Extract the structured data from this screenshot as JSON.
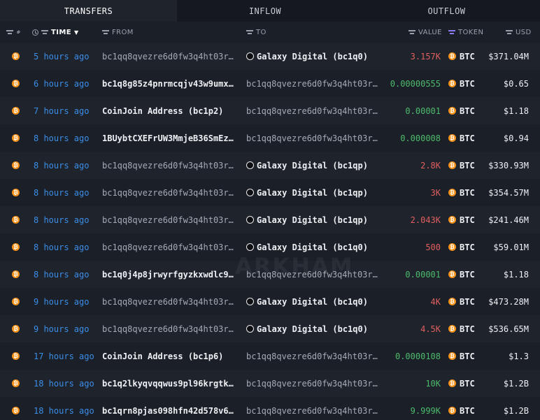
{
  "tabs": [
    "TRANSFERS",
    "INFLOW",
    "OUTFLOW"
  ],
  "active_tab": 0,
  "columns": {
    "time": "TIME",
    "from": "FROM",
    "to": "TO",
    "value": "VALUE",
    "token": "TOKEN",
    "usd": "USD"
  },
  "watermark": "ARKHAM",
  "rows": [
    {
      "time": "5 hours ago",
      "from": "bc1qq8qvezre6d0fw3q4ht03r…",
      "from_type": "addr",
      "to": "Galaxy Digital (bc1q0)",
      "to_type": "entity",
      "value": "3.157K",
      "value_color": "red",
      "token": "BTC",
      "usd": "$371.04M"
    },
    {
      "time": "6 hours ago",
      "from": "bc1q8g85z4pnrmcqjv43w9umx…",
      "from_type": "bright",
      "to": "bc1qq8qvezre6d0fw3q4ht03r…",
      "to_type": "addr",
      "value": "0.00000555",
      "value_color": "green",
      "token": "BTC",
      "usd": "$0.65"
    },
    {
      "time": "7 hours ago",
      "from": "CoinJoin Address (bc1p2)",
      "from_type": "bright",
      "to": "bc1qq8qvezre6d0fw3q4ht03r…",
      "to_type": "addr",
      "value": "0.00001",
      "value_color": "green",
      "token": "BTC",
      "usd": "$1.18"
    },
    {
      "time": "8 hours ago",
      "from": "1BUybtCXEFrUW3MmjeB36SmEz…",
      "from_type": "bright",
      "to": "bc1qq8qvezre6d0fw3q4ht03r…",
      "to_type": "addr",
      "value": "0.000008",
      "value_color": "green",
      "token": "BTC",
      "usd": "$0.94"
    },
    {
      "time": "8 hours ago",
      "from": "bc1qq8qvezre6d0fw3q4ht03r…",
      "from_type": "addr",
      "to": "Galaxy Digital (bc1qp)",
      "to_type": "entity",
      "value": "2.8K",
      "value_color": "red",
      "token": "BTC",
      "usd": "$330.93M"
    },
    {
      "time": "8 hours ago",
      "from": "bc1qq8qvezre6d0fw3q4ht03r…",
      "from_type": "addr",
      "to": "Galaxy Digital (bc1qp)",
      "to_type": "entity",
      "value": "3K",
      "value_color": "red",
      "token": "BTC",
      "usd": "$354.57M"
    },
    {
      "time": "8 hours ago",
      "from": "bc1qq8qvezre6d0fw3q4ht03r…",
      "from_type": "addr",
      "to": "Galaxy Digital (bc1qp)",
      "to_type": "entity",
      "value": "2.043K",
      "value_color": "red",
      "token": "BTC",
      "usd": "$241.46M"
    },
    {
      "time": "8 hours ago",
      "from": "bc1qq8qvezre6d0fw3q4ht03r…",
      "from_type": "addr",
      "to": "Galaxy Digital (bc1q0)",
      "to_type": "entity",
      "value": "500",
      "value_color": "red",
      "token": "BTC",
      "usd": "$59.01M"
    },
    {
      "time": "8 hours ago",
      "from": "bc1q0j4p8jrwyrfgyzkxwdlc9…",
      "from_type": "bright",
      "to": "bc1qq8qvezre6d0fw3q4ht03r…",
      "to_type": "addr",
      "value": "0.00001",
      "value_color": "green",
      "token": "BTC",
      "usd": "$1.18"
    },
    {
      "time": "9 hours ago",
      "from": "bc1qq8qvezre6d0fw3q4ht03r…",
      "from_type": "addr",
      "to": "Galaxy Digital (bc1q0)",
      "to_type": "entity",
      "value": "4K",
      "value_color": "red",
      "token": "BTC",
      "usd": "$473.28M"
    },
    {
      "time": "9 hours ago",
      "from": "bc1qq8qvezre6d0fw3q4ht03r…",
      "from_type": "addr",
      "to": "Galaxy Digital (bc1q0)",
      "to_type": "entity",
      "value": "4.5K",
      "value_color": "red",
      "token": "BTC",
      "usd": "$536.65M"
    },
    {
      "time": "17 hours ago",
      "from": "CoinJoin Address (bc1p6)",
      "from_type": "bright",
      "to": "bc1qq8qvezre6d0fw3q4ht03r…",
      "to_type": "addr",
      "value": "0.0000108",
      "value_color": "green",
      "token": "BTC",
      "usd": "$1.3"
    },
    {
      "time": "18 hours ago",
      "from": "bc1q2lkyqvqqwus9pl96krgtk…",
      "from_type": "bright",
      "to": "bc1qq8qvezre6d0fw3q4ht03r…",
      "to_type": "addr",
      "value": "10K",
      "value_color": "green",
      "token": "BTC",
      "usd": "$1.2B"
    },
    {
      "time": "18 hours ago",
      "from": "bc1qrn8pjas098hfn42d578v6…",
      "from_type": "bright",
      "to": "bc1qq8qvezre6d0fw3q4ht03r…",
      "to_type": "addr",
      "value": "9.999K",
      "value_color": "green",
      "token": "BTC",
      "usd": "$1.2B"
    }
  ]
}
